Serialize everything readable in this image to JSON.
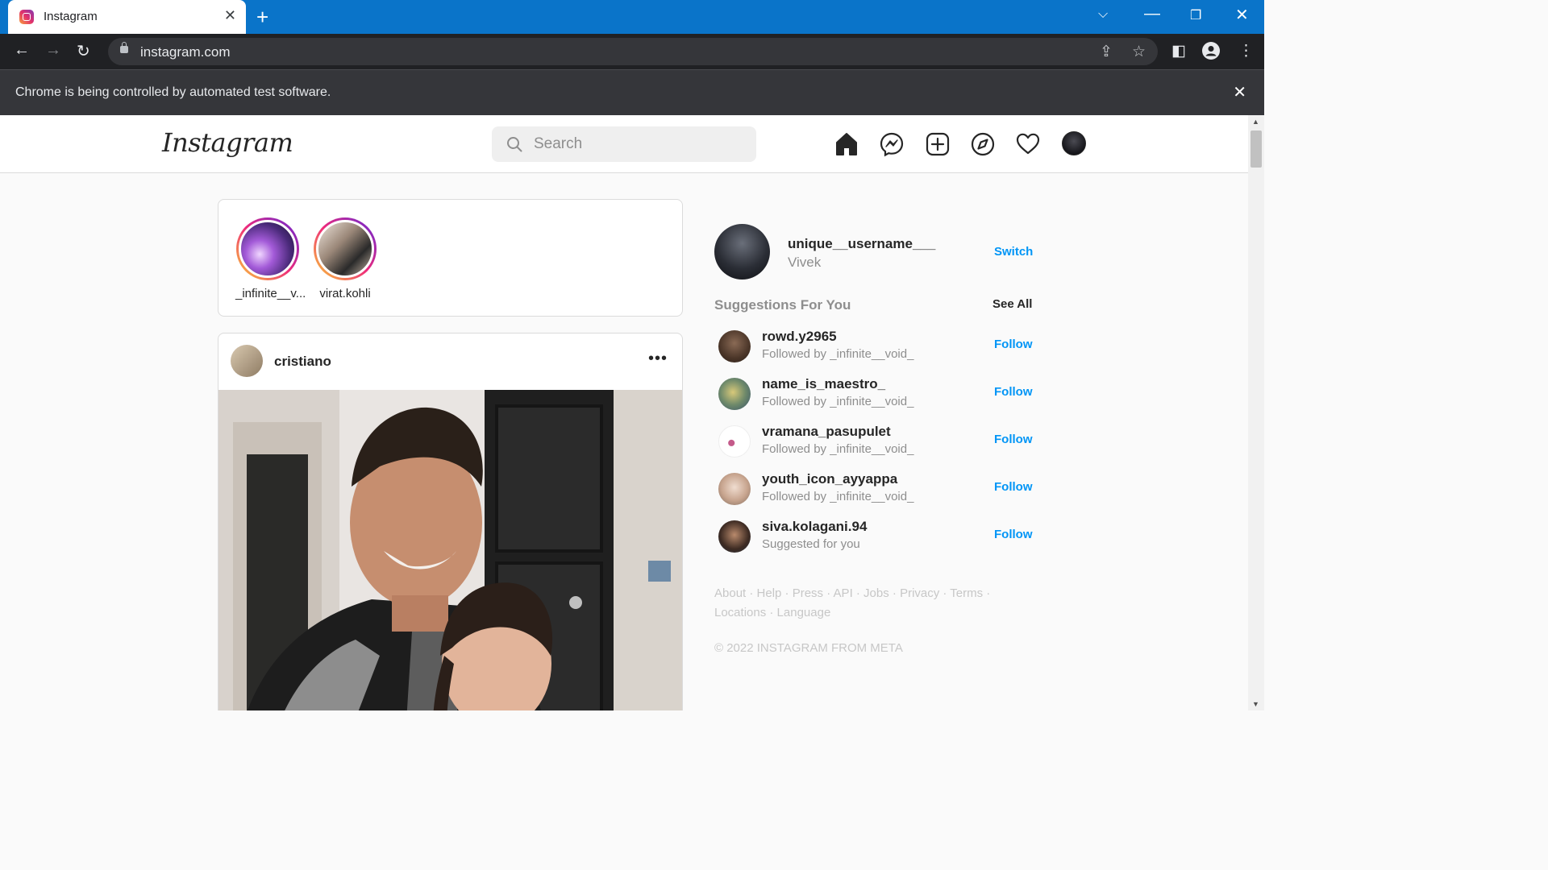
{
  "browser": {
    "tab_title": "Instagram",
    "url": "instagram.com",
    "automation_notice": "Chrome is being controlled by automated test software."
  },
  "header": {
    "logo": "Instagram",
    "search_placeholder": "Search"
  },
  "stories": [
    {
      "label": "_infinite__v..."
    },
    {
      "label": "virat.kohli"
    }
  ],
  "post": {
    "username": "cristiano"
  },
  "profile": {
    "username": "unique__username___",
    "name": "Vivek",
    "switch_label": "Switch"
  },
  "suggestions": {
    "title": "Suggestions For You",
    "see_all": "See All",
    "follow_label": "Follow",
    "items": [
      {
        "username": "rowd.y2965",
        "subtitle": "Followed by _infinite__void_"
      },
      {
        "username": "name_is_maestro_",
        "subtitle": "Followed by _infinite__void_"
      },
      {
        "username": "vramana_pasupulet",
        "subtitle": "Followed by _infinite__void_"
      },
      {
        "username": "youth_icon_ayyappa",
        "subtitle": "Followed by _infinite__void_"
      },
      {
        "username": "siva.kolagani.94",
        "subtitle": "Suggested for you"
      }
    ]
  },
  "footer": {
    "links": "About · Help · Press · API · Jobs · Privacy · Terms · Locations · Language",
    "copyright": "© 2022 INSTAGRAM FROM META"
  },
  "colors": {
    "chrome_titlebar": "#0a74c9",
    "link_blue": "#0095f6",
    "muted_text": "#8e8e8e"
  }
}
